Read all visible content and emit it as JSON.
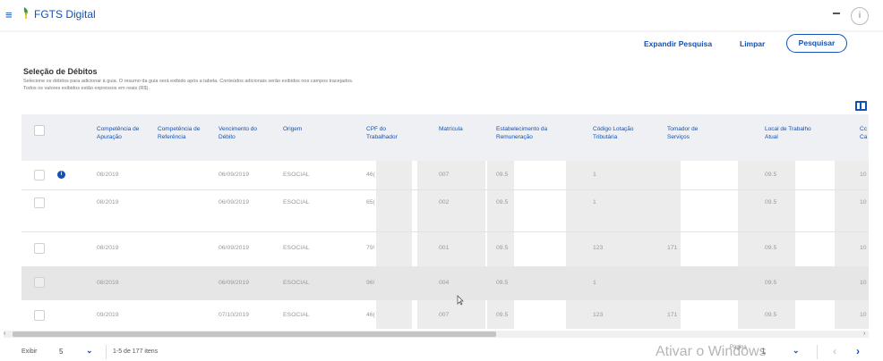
{
  "app": {
    "title": "FGTS Digital"
  },
  "actions": {
    "expand": "Expandir Pesquisa",
    "clear": "Limpar",
    "search": "Pesquisar"
  },
  "section": {
    "title": "Seleção de Débitos",
    "desc1": "Selecione os débitos para adicionar à guia. O resumo da guia será exibido após a tabela. Conteúdos adicionais serão exibidos nos campos tracejados.",
    "desc2": "Todos os valores exibidos estão expressos em reais (R$)."
  },
  "table": {
    "headers": [
      "Competência de Apuração",
      "Competência de Referência",
      "Vencimento do Débito",
      "Origem",
      "CPF do Trabalhador",
      "Matrícula",
      "Estabelecimento da Remuneração",
      "Código Lotação Tributária",
      "Tomador de Serviços",
      "Local de Trabalho Atual",
      "Cc Ca"
    ],
    "rows": [
      {
        "apuracao": "08/2019",
        "referencia": "",
        "vencimento": "06/09/2019",
        "origem": "ESOCIAL",
        "cpf": "46(",
        "matricula": "007",
        "estab": "09.5",
        "lotacao": "1",
        "tomador": "",
        "local": "09.5",
        "extra": "10"
      },
      {
        "apuracao": "08/2019",
        "referencia": "",
        "vencimento": "06/09/2019",
        "origem": "ESOCIAL",
        "cpf": "65(",
        "matricula": "002",
        "estab": "09.5",
        "lotacao": "1",
        "tomador": "",
        "local": "09.5",
        "extra": "10"
      },
      {
        "apuracao": "08/2019",
        "referencia": "",
        "vencimento": "06/09/2019",
        "origem": "ESOCIAL",
        "cpf": "79!",
        "matricula": "001",
        "estab": "09.5",
        "lotacao": "123",
        "tomador": "171",
        "local": "09.5",
        "extra": "10"
      },
      {
        "apuracao": "08/2019",
        "referencia": "",
        "vencimento": "06/09/2019",
        "origem": "ESOCIAL",
        "cpf": "96!",
        "matricula": "004",
        "estab": "09.5",
        "lotacao": "1",
        "tomador": "",
        "local": "09.5",
        "extra": "10"
      },
      {
        "apuracao": "09/2019",
        "referencia": "",
        "vencimento": "07/10/2019",
        "origem": "ESOCIAL",
        "cpf": "46(",
        "matricula": "007",
        "estab": "09.5",
        "lotacao": "123",
        "tomador": "171",
        "local": "09.5",
        "extra": "10"
      }
    ]
  },
  "footer": {
    "show_label": "Exibir",
    "page_size": "5",
    "range": "1-5 de 177 itens",
    "page_label": "Página",
    "page": "1"
  },
  "watermark": "Ativar o Windows",
  "colors": {
    "accent": "#1351b4",
    "header_bg": "#eef0f4",
    "shade": "#e6e6e6"
  }
}
